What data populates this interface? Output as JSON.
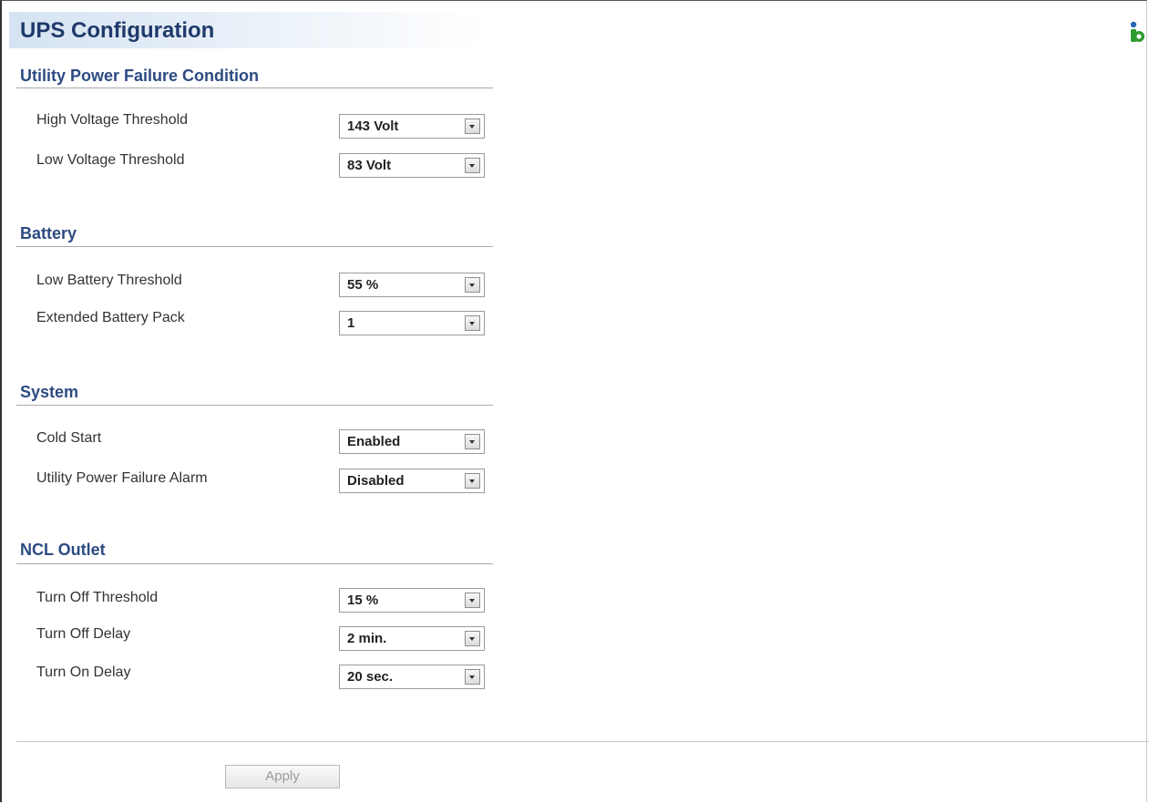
{
  "page": {
    "title": "UPS Configuration",
    "help_icon": "info-icon"
  },
  "sections": {
    "utility": {
      "heading": "Utility Power Failure Condition",
      "fields": [
        {
          "label": "High Voltage Threshold",
          "value": "143 Volt"
        },
        {
          "label": "Low Voltage Threshold",
          "value": "83 Volt"
        }
      ]
    },
    "battery": {
      "heading": "Battery",
      "fields": [
        {
          "label": "Low Battery Threshold",
          "value": "55 %"
        },
        {
          "label": "Extended Battery Pack",
          "value": "1"
        }
      ]
    },
    "system": {
      "heading": "System",
      "fields": [
        {
          "label": "Cold Start",
          "value": "Enabled"
        },
        {
          "label": "Utility Power Failure Alarm",
          "value": "Disabled"
        }
      ]
    },
    "ncl": {
      "heading": "NCL Outlet",
      "fields": [
        {
          "label": "Turn Off Threshold",
          "value": "15 %"
        },
        {
          "label": "Turn Off Delay",
          "value": "2 min."
        },
        {
          "label": "Turn On Delay",
          "value": "20 sec."
        }
      ]
    }
  },
  "actions": {
    "apply_label": "Apply"
  },
  "colors": {
    "heading": "#2d4b82",
    "title": "#1f3a6b",
    "help_icon_green": "#2f9a2f",
    "help_icon_blue": "#2a64b8"
  }
}
